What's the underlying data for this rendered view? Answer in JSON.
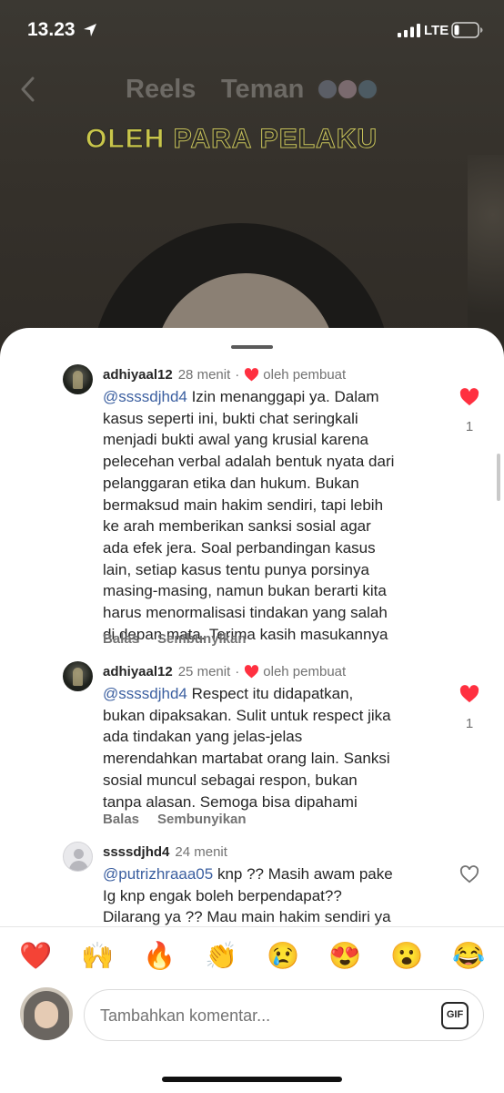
{
  "status_bar": {
    "time": "13.23",
    "network": "LTE"
  },
  "reel": {
    "tabs": [
      "Reels",
      "Teman"
    ],
    "caption_highlight": "OLEH",
    "caption_rest": " PARA PELAKU"
  },
  "comments": [
    {
      "username": "adhiyaal12",
      "time": "28 menit",
      "separator": "·",
      "creator_label": "oleh pembuat",
      "mention": "@ssssdjhd4",
      "lines": [
        " Izin menanggapi ya. Dalam",
        "kasus seperti ini, bukti chat seringkali",
        "menjadi bukti awal yang krusial karena",
        "pelecehan verbal adalah bentuk nyata dari",
        "pelanggaran etika dan hukum. Bukan",
        "bermaksud main hakim sendiri, tapi lebih",
        "ke arah memberikan sanksi sosial agar",
        "ada efek jera. Soal perbandingan kasus",
        "lain, setiap kasus tentu punya porsinya",
        "masing-masing, namun bukan berarti kita",
        "harus menormalisasi tindakan yang salah",
        "di depan mata. Terima kasih masukannya"
      ],
      "reply_label": "Balas",
      "hide_label": "Sembunyikan",
      "like_count": "1",
      "liked": true
    },
    {
      "username": "adhiyaal12",
      "time": "25 menit",
      "separator": "·",
      "creator_label": "oleh pembuat",
      "mention": "@ssssdjhd4",
      "lines": [
        " Respect itu didapatkan,",
        "bukan dipaksakan. Sulit untuk respect jika",
        "ada tindakan yang jelas-jelas",
        "merendahkan martabat orang lain. Sanksi",
        "sosial muncul sebagai respon, bukan",
        "tanpa alasan. Semoga bisa dipahami"
      ],
      "reply_label": "Balas",
      "hide_label": "Sembunyikan",
      "like_count": "1",
      "liked": true
    },
    {
      "username": "ssssdjhd4",
      "time": "24 menit",
      "mention": "@putrizhraaa05",
      "lines": [
        " knp ?? Masih awam pake",
        "Ig knp engak boleh berpendapat??",
        "Dilarang ya ?? Mau main hakim sendiri ya"
      ],
      "liked": false
    }
  ],
  "emoji_bar": [
    "❤️",
    "🙌",
    "🔥",
    "👏",
    "😢",
    "😍",
    "😮",
    "😂"
  ],
  "composer": {
    "placeholder": "Tambahkan komentar...",
    "gif_label": "GIF"
  },
  "colors": {
    "like_red": "#ff3040",
    "mention_blue": "#3b5fa0",
    "muted_text": "#737373"
  }
}
